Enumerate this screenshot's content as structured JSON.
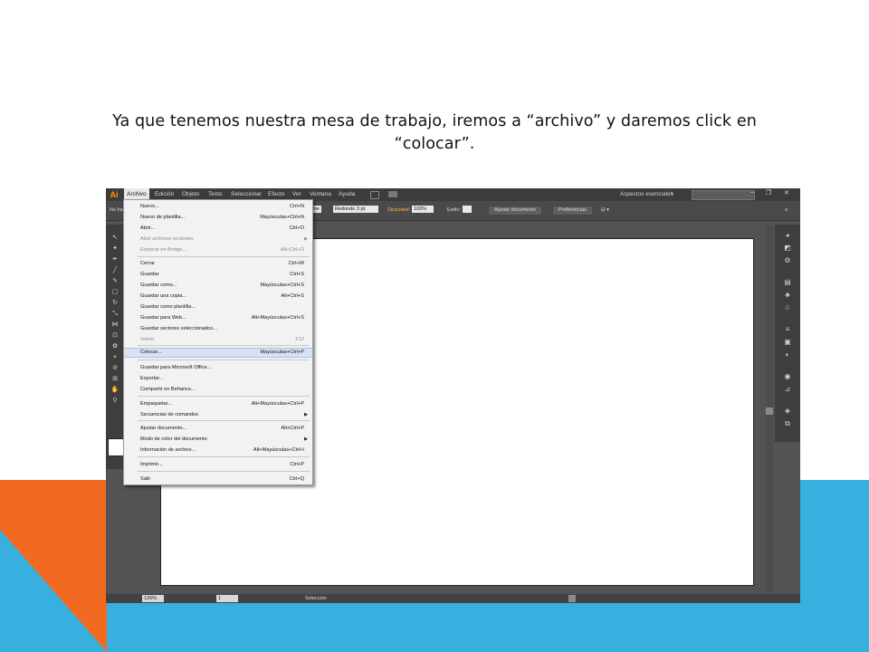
{
  "slide": {
    "line1": "Ya que tenemos nuestra mesa de trabajo, iremos a “archivo” y daremos click en",
    "line2": "“colocar”."
  },
  "app": {
    "logo": "Ai",
    "menus": [
      "Archivo",
      "Edición",
      "Objeto",
      "Texto",
      "Seleccionar",
      "Efecto",
      "Ver",
      "Ventana",
      "Ayuda"
    ],
    "workspace_label": "Aspectos esenciales",
    "window_buttons": [
      "–",
      "❐",
      "✕"
    ]
  },
  "control_bar": {
    "no_selection": "No ha",
    "stroke_profile": "me",
    "brush": "Redondo 3 pt.",
    "opacity_label": "Opacidad:",
    "opacity_value": "100%",
    "style_label": "Estilo:",
    "doc_button": "Ajustar documento",
    "prefs_button": "Preferencias"
  },
  "status_bar": {
    "zoom": "126%",
    "page": "1",
    "selection": "Selección"
  },
  "file_menu": {
    "items": [
      {
        "label": "Nuevo...",
        "shortcut": "Ctrl+N"
      },
      {
        "label": "Nuevo de plantilla...",
        "shortcut": "Mayúsculas+Ctrl+N"
      },
      {
        "label": "Abrir...",
        "shortcut": "Ctrl+O"
      },
      {
        "label": "Abrir archivos recientes",
        "shortcut": ""
      },
      {
        "label": "Explorar en Bridge...",
        "shortcut": "Alt+Ctrl+O"
      },
      {
        "label": "Cerrar",
        "shortcut": "Ctrl+W"
      },
      {
        "label": "Guardar",
        "shortcut": "Ctrl+S"
      },
      {
        "label": "Guardar como...",
        "shortcut": "Mayúsculas+Ctrl+S"
      },
      {
        "label": "Guardar una copia...",
        "shortcut": "Alt+Ctrl+S"
      },
      {
        "label": "Guardar como plantilla...",
        "shortcut": ""
      },
      {
        "label": "Guardar para Web...",
        "shortcut": "Alt+Mayúsculas+Ctrl+S"
      },
      {
        "label": "Guardar sectores seleccionados...",
        "shortcut": ""
      },
      {
        "label": "Volver",
        "shortcut": "F12"
      },
      {
        "label": "Colocar...",
        "shortcut": "Mayúsculas+Ctrl+P"
      },
      {
        "label": "Guardar para Microsoft Office...",
        "shortcut": ""
      },
      {
        "label": "Exportar...",
        "shortcut": ""
      },
      {
        "label": "Compartir en Behance...",
        "shortcut": ""
      },
      {
        "label": "Empaquetar...",
        "shortcut": "Alt+Mayúsculas+Ctrl+P"
      },
      {
        "label": "Secuencias de comandos",
        "shortcut": ""
      },
      {
        "label": "Ajustar documento...",
        "shortcut": "Alt+Ctrl+P"
      },
      {
        "label": "Modo de color del documento",
        "shortcut": ""
      },
      {
        "label": "Información de archivo...",
        "shortcut": "Alt+Mayúsculas+Ctrl+I"
      },
      {
        "label": "Imprimir...",
        "shortcut": "Ctrl+P"
      },
      {
        "label": "Salir",
        "shortcut": "Ctrl+Q"
      }
    ]
  },
  "colors": {
    "accent_orange": "#f26a21",
    "accent_blue": "#37b0df",
    "menu_highlight": "#d7e3f3",
    "ai_logo": "#ff9a00"
  }
}
